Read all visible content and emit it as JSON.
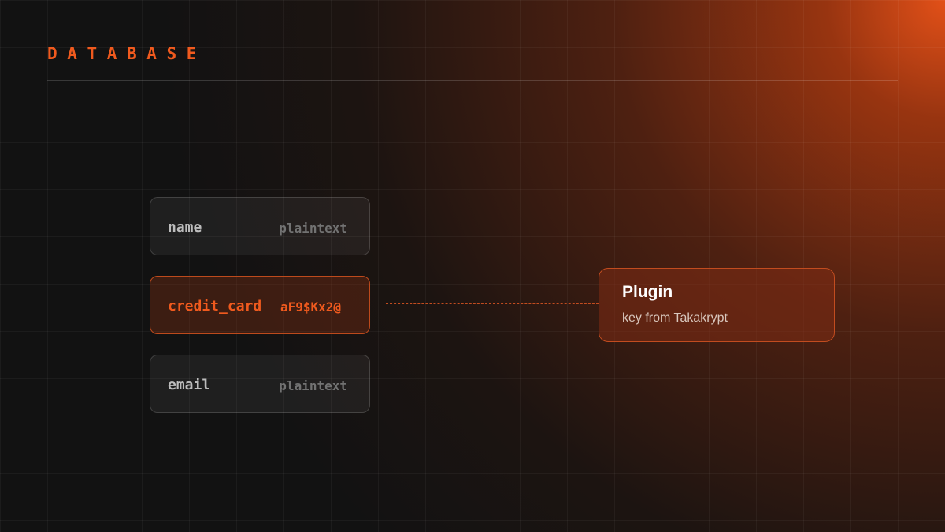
{
  "header": {
    "title": "DATABASE"
  },
  "fields": [
    {
      "name": "name",
      "value": "plaintext",
      "encrypted": false
    },
    {
      "name": "credit_card",
      "value": "aF9$Kx2@",
      "encrypted": true
    },
    {
      "name": "email",
      "value": "plaintext",
      "encrypted": false
    }
  ],
  "plugin": {
    "title": "Plugin",
    "subtitle": "key from Takakrypt"
  },
  "colors": {
    "accent": "#f05a1e",
    "background": "#121212",
    "glow": "#e25018",
    "plaintext_label": "#bcbcbc",
    "plaintext_value": "#727272"
  }
}
